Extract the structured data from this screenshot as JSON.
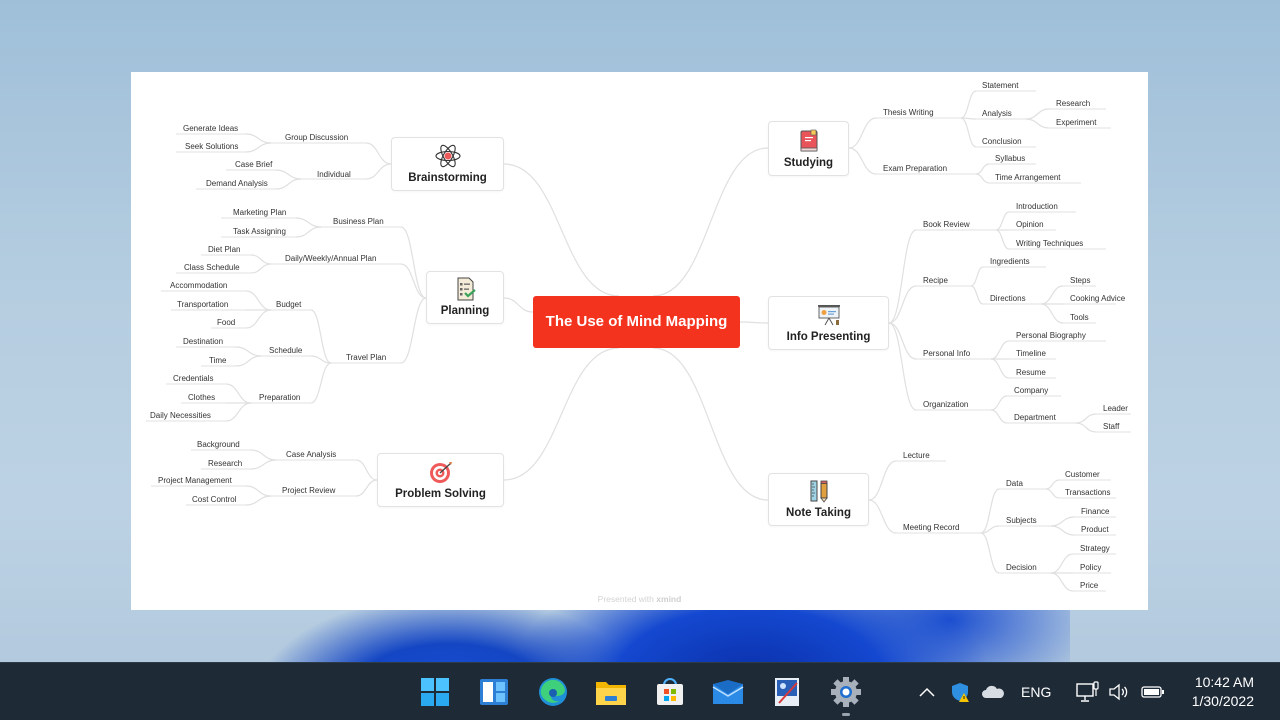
{
  "mindmap": {
    "central": "The Use of Mind Mapping",
    "footer_prefix": "Presented with",
    "footer_brand": "xmind",
    "accent": "#f4331f",
    "branches": {
      "brainstorming": {
        "title": "Brainstorming",
        "icon": "atom-icon",
        "children": [
          {
            "label": "Group Discussion",
            "children": [
              "Generate Ideas",
              "Seek Solutions"
            ]
          },
          {
            "label": "Individual",
            "children": [
              "Case Brief",
              "Demand Analysis"
            ]
          }
        ]
      },
      "planning": {
        "title": "Planning",
        "icon": "checklist-icon",
        "children": [
          {
            "label": "Business Plan",
            "children": [
              "Marketing Plan",
              "Task Assigning"
            ]
          },
          {
            "label": "Daily/Weekly/Annual Plan",
            "children": [
              "Diet Plan",
              "Class Schedule"
            ]
          },
          {
            "label": "Travel Plan",
            "children": [
              {
                "label": "Budget",
                "children": [
                  "Accommodation",
                  "Transportation",
                  "Food"
                ]
              },
              {
                "label": "Schedule",
                "children": [
                  "Destination",
                  "Time"
                ]
              },
              {
                "label": "Preparation",
                "children": [
                  "Credentials",
                  "Clothes",
                  "Daily Necessities"
                ]
              }
            ]
          }
        ]
      },
      "problem_solving": {
        "title": "Problem Solving",
        "icon": "target-icon",
        "children": [
          {
            "label": "Case Analysis",
            "children": [
              "Background",
              "Research"
            ]
          },
          {
            "label": "Project Review",
            "children": [
              "Project Management",
              "Cost Control"
            ]
          }
        ]
      },
      "studying": {
        "title": "Studying",
        "icon": "book-icon",
        "children": [
          {
            "label": "Thesis Writing",
            "children": [
              "Statement",
              {
                "label": "Analysis",
                "children": [
                  "Research",
                  "Experiment"
                ]
              },
              "Conclusion"
            ]
          },
          {
            "label": "Exam Preparation",
            "children": [
              "Syllabus",
              "Time Arrangement"
            ]
          }
        ]
      },
      "info_presenting": {
        "title": "Info Presenting",
        "icon": "presentation-board-icon",
        "children": [
          {
            "label": "Book Review",
            "children": [
              "Introduction",
              "Opinion",
              "Writing Techniques"
            ]
          },
          {
            "label": "Recipe",
            "children": [
              "Ingredients",
              {
                "label": "Directions",
                "children": [
                  "Steps",
                  "Cooking Advice",
                  "Tools"
                ]
              }
            ]
          },
          {
            "label": "Personal Info",
            "children": [
              "Personal Biography",
              "Timeline",
              "Resume"
            ]
          },
          {
            "label": "Organization",
            "children": [
              "Company",
              {
                "label": "Department",
                "children": [
                  "Leader",
                  "Staff"
                ]
              }
            ]
          }
        ]
      },
      "note_taking": {
        "title": "Note Taking",
        "icon": "ruler-pencil-icon",
        "children": [
          {
            "label": "Lecture",
            "children": []
          },
          {
            "label": "Meeting Record",
            "children": [
              {
                "label": "Data",
                "children": [
                  "Customer",
                  "Transactions"
                ]
              },
              {
                "label": "Subjects",
                "children": [
                  "Finance",
                  "Product"
                ]
              },
              {
                "label": "Decision",
                "children": [
                  "Strategy",
                  "Policy",
                  "Price"
                ]
              }
            ]
          }
        ]
      }
    }
  },
  "taskbar": {
    "apps": [
      {
        "name": "start",
        "icon": "windows-start-icon"
      },
      {
        "name": "widgets",
        "icon": "widgets-icon"
      },
      {
        "name": "edge",
        "icon": "edge-browser-icon"
      },
      {
        "name": "file-explorer",
        "icon": "folder-icon"
      },
      {
        "name": "store",
        "icon": "store-icon"
      },
      {
        "name": "mail",
        "icon": "mail-icon"
      },
      {
        "name": "paint",
        "icon": "paint-icon"
      },
      {
        "name": "settings",
        "icon": "gear-icon"
      }
    ],
    "language": "ENG",
    "time": "10:42 AM",
    "date": "1/30/2022"
  }
}
